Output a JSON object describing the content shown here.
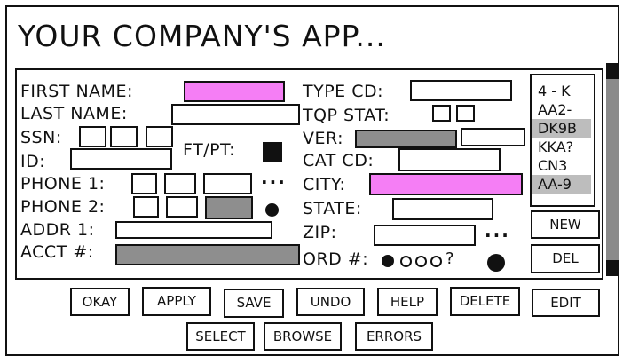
{
  "app": {
    "title": "YOUR COMPANY'S APP..."
  },
  "form": {
    "first_name_label": "FIRST NAME:",
    "last_name_label": "LAST NAME:",
    "ssn_label": "SSN:",
    "id_label": "ID:",
    "phone1_label": "PHONE 1:",
    "phone2_label": "PHONE 2:",
    "addr1_label": "ADDR 1:",
    "acct_label": "ACCT #:",
    "ftpt_label": "FT/PT:",
    "type_cd_label": "TYPE CD:",
    "tqp_stat_label": "TQP STAT:",
    "ver_label": "VER:",
    "cat_cd_label": "CAT CD:",
    "city_label": "CITY:",
    "state_label": "STATE:",
    "zip_label": "ZIP:",
    "ord_label": "ORD #:",
    "ord_question": "?",
    "more_dots": "...",
    "colors": {
      "highlight": "#f57ef5",
      "disabled": "#8e8e8e",
      "selected_row": "#bdbdbd"
    }
  },
  "list": {
    "items": [
      "4 - K",
      "AA2-",
      "DK9B",
      "KKA?",
      "CN3",
      "AA-9"
    ],
    "selected": [
      "DK9B",
      "AA-9"
    ],
    "new_label": "NEW",
    "del_label": "DEL"
  },
  "buttons": {
    "okay": "OKAY",
    "apply": "APPLY",
    "save": "SAVE",
    "undo": "UNDO",
    "help": "HELP",
    "delete": "DELETE",
    "edit": "EDIT",
    "select": "SELECT",
    "browse": "BROWSE",
    "errors": "ERRORS"
  }
}
